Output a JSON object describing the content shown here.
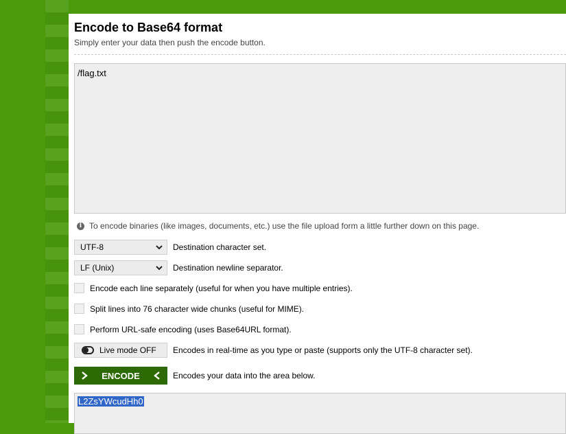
{
  "page": {
    "title": "Encode to Base64 format",
    "subtitle": "Simply enter your data then push the encode button."
  },
  "input": {
    "value": "/flag.txt"
  },
  "info": {
    "icon": "info-icon",
    "text": "To encode binaries (like images, documents, etc.) use the file upload form a little further down on this page."
  },
  "options": {
    "charset": {
      "selected": "UTF-8",
      "label": "Destination character set."
    },
    "newline": {
      "selected": "LF (Unix)",
      "label": "Destination newline separator."
    },
    "each_line": {
      "label": "Encode each line separately (useful for when you have multiple entries).",
      "checked": false
    },
    "split_lines": {
      "label": "Split lines into 76 character wide chunks (useful for MIME).",
      "checked": false
    },
    "url_safe": {
      "label": "Perform URL-safe encoding (uses Base64URL format).",
      "checked": false
    },
    "live_mode": {
      "button": "Live mode OFF",
      "label": "Encodes in real-time as you type or paste (supports only the UTF-8 character set)."
    }
  },
  "encode": {
    "button": "ENCODE",
    "label": "Encodes your data into the area below."
  },
  "output": {
    "value": "L2ZsYWcudHh0"
  },
  "colors": {
    "brand_green": "#4a9a0c",
    "button_green": "#2d6a06",
    "selection_blue": "#3166c9"
  }
}
